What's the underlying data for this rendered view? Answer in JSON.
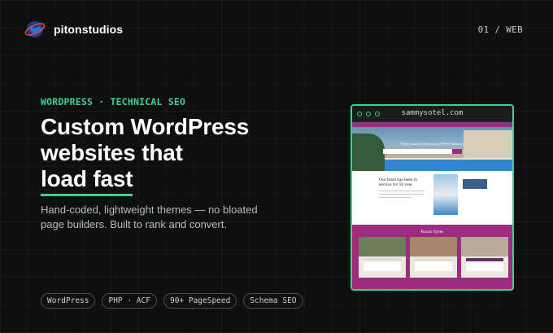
{
  "brand": {
    "name": "pitonstudios",
    "logo_icon": "globe-logo-icon"
  },
  "page_counter": "01 / WEB",
  "eyebrow": "WORDPRESS · TECHNICAL SEO",
  "headline": {
    "line1": "Custom WordPress",
    "line2": "websites that",
    "line3": "load fast"
  },
  "subtext": {
    "line1": "Hand-coded, lightweight themes — no bloated",
    "line2": "page builders. Built to rank and convert."
  },
  "tags": [
    "WordPress",
    "PHP · ACF",
    "90+ PageSpeed",
    "Schema SEO"
  ],
  "mockup": {
    "url": "sammysotel.com",
    "site": {
      "hero_caption": "Enjoy comfort and peace at Hotel Sammy's",
      "about_title": "Our hotel has been in service for 50 year",
      "rooms_title": "Room Types"
    }
  },
  "colors": {
    "accent": "#3fd18e",
    "background": "#0e0f0f",
    "site_brand": "#9b2c7f"
  }
}
